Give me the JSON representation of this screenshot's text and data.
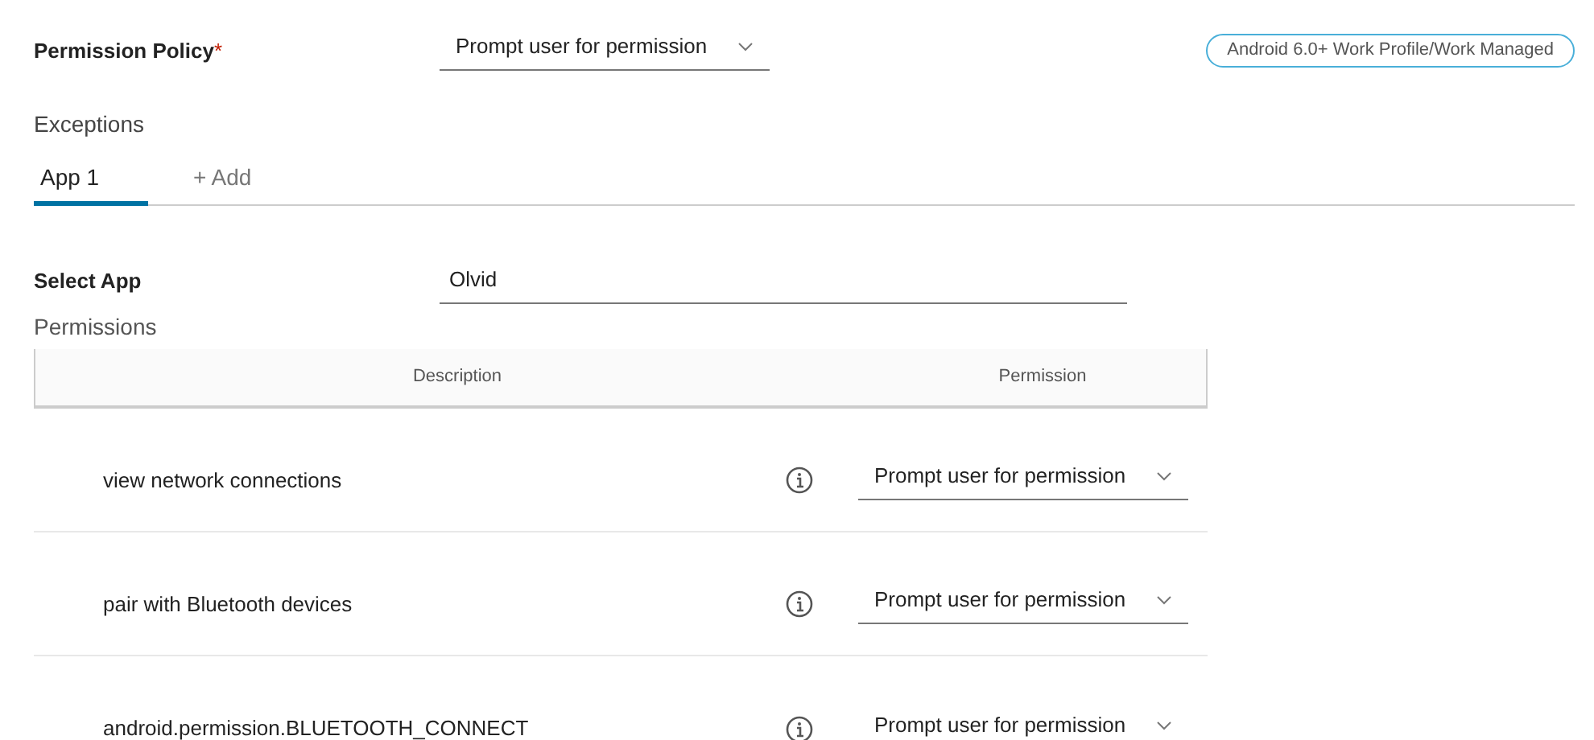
{
  "policy": {
    "label": "Permission Policy",
    "required_mark": "*",
    "value": "Prompt user for permission",
    "badge": "Android 6.0+ Work Profile/Work Managed"
  },
  "exceptions": {
    "title": "Exceptions",
    "tabs": [
      {
        "label": "App 1",
        "selected": true
      },
      {
        "label": "+ Add",
        "selected": false
      }
    ]
  },
  "select_app": {
    "label": "Select App",
    "value": "Olvid"
  },
  "permissions": {
    "title": "Permissions",
    "columns": [
      "Description",
      "Permission"
    ],
    "rows": [
      {
        "description": "view network connections",
        "permission": "Prompt user for permission"
      },
      {
        "description": "pair with Bluetooth devices",
        "permission": "Prompt user for permission"
      },
      {
        "description": "android.permission.BLUETOOTH_CONNECT",
        "permission": "Prompt user for permission"
      }
    ]
  }
}
